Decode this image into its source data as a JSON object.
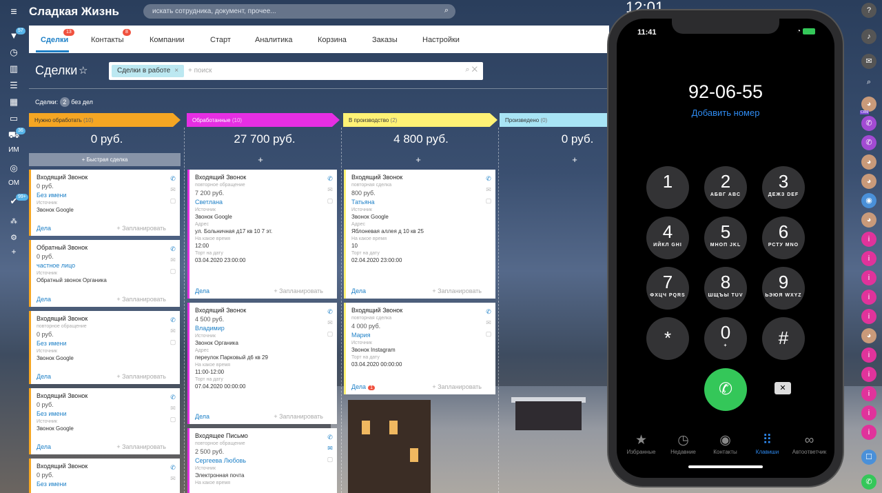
{
  "app": {
    "brand": "Сладкая Жизнь",
    "search_placeholder": "искать сотрудника, документ, прочее...",
    "clock": "12:01"
  },
  "left_sidebar": {
    "badge_top": "57",
    "badge_cart": "36",
    "badge_bottom": "99+",
    "label_im": "ИМ",
    "label_om": "ОМ"
  },
  "tabs": [
    {
      "label": "Сделки",
      "badge": "13"
    },
    {
      "label": "Контакты",
      "badge": "8"
    },
    {
      "label": "Компании"
    },
    {
      "label": "Старт"
    },
    {
      "label": "Аналитика"
    },
    {
      "label": "Корзина"
    },
    {
      "label": "Заказы"
    },
    {
      "label": "Настройки"
    }
  ],
  "page": {
    "title": "Сделки",
    "filter_chip": "Сделки в работе",
    "filter_placeholder": "+ поиск",
    "count_prefix": "Сделки:",
    "count_value": "2",
    "count_suffix": "без дел",
    "quick_deal": "Быстрая сделка"
  },
  "columns": [
    {
      "name": "Нужно обработать",
      "count": "(10)",
      "sum": "0 руб.",
      "color": "#f5a623"
    },
    {
      "name": "Обработанные",
      "count": "(10)",
      "sum": "27 700 руб.",
      "color": "#e62ee3"
    },
    {
      "name": "В производство",
      "count": "(2)",
      "sum": "4 800 руб.",
      "color": "#fff275"
    },
    {
      "name": "Произведено",
      "count": "(0)",
      "sum": "0 руб.",
      "color": "#a8e4f5"
    }
  ],
  "common": {
    "deals": "Дела",
    "plan": "+ Запланировать",
    "lbl_source": "Источник",
    "lbl_address": "Адрес",
    "lbl_time": "На какое время",
    "lbl_cake_date": "Торт на дату"
  },
  "cards": {
    "c1": {
      "title": "Входящий Звонок",
      "sum": "0 руб.",
      "client": "Без имени",
      "source": "Звонок Google"
    },
    "c2": {
      "title": "Обратный Звонок",
      "sum": "0 руб.",
      "client": "частное лицо",
      "source": "Обратный звонок Органика"
    },
    "c3": {
      "title": "Входящий Звонок",
      "sub": "повторное обращение",
      "sum": "0 руб.",
      "client": "Без имени",
      "source": "Звонок Google"
    },
    "c4": {
      "title": "Входящий Звонок",
      "sum": "0 руб.",
      "client": "Без имени",
      "source": "Звонок Google"
    },
    "c5": {
      "title": "Входящий Звонок",
      "sum": "0 руб.",
      "client": "Без имени"
    },
    "d1": {
      "title": "Входящий Звонок",
      "sub": "повторное обращение",
      "sum": "7 200 руб.",
      "client": "Светлана",
      "source": "Звонок Google",
      "address": "ул. Больничная д17 кв 10 7 эт.",
      "time": "12:00",
      "date": "03.04.2020 23:00:00"
    },
    "d2": {
      "title": "Входящий Звонок",
      "sum": "4 500 руб.",
      "client": "Владимир",
      "source": "Звонок Органика",
      "address": "переулок Парковый д6 кв 29",
      "time": "11:00-12:00",
      "date": "07.04.2020 00:00:00"
    },
    "d3": {
      "title": "Входящее Письмо",
      "sub": "повторное обращение",
      "sum": "2 500 руб.",
      "client": "Сергеева Любовь",
      "source": "Электронная почта",
      "lbl_time": "На какое время"
    },
    "p1": {
      "title": "Входящий Звонок",
      "sub": "повторная сделка",
      "sum": "800 руб.",
      "client": "Татьяна",
      "source": "Звонок Google",
      "address": "Яблоневая аллея д 10 кв 25",
      "time": "10",
      "date": "02.04.2020 23:00:00"
    },
    "p2": {
      "title": "Входящий Звонок",
      "sub": "повторная сделка",
      "sum": "4 000 руб.",
      "client": "Мария",
      "source": "Звонок Instagram",
      "date": "03.04.2020 00:00:00",
      "deals_badge": "1"
    }
  },
  "phone": {
    "time": "11:41",
    "number": "92-06-55",
    "add_number": "Добавить номер",
    "keys": [
      {
        "d": "1",
        "l": ""
      },
      {
        "d": "2",
        "l": "АБВГ ABC"
      },
      {
        "d": "3",
        "l": "ДЕЖЗ DEF"
      },
      {
        "d": "4",
        "l": "ИЙКЛ GHI"
      },
      {
        "d": "5",
        "l": "МНОП JKL"
      },
      {
        "d": "6",
        "l": "РСТУ MNO"
      },
      {
        "d": "7",
        "l": "ФХЦЧ PQRS"
      },
      {
        "d": "8",
        "l": "ШЩЪЫ TUV"
      },
      {
        "d": "9",
        "l": "ЬЭЮЯ WXYZ"
      },
      {
        "d": "*",
        "l": ""
      },
      {
        "d": "0",
        "l": "+"
      },
      {
        "d": "#",
        "l": ""
      }
    ],
    "tabbar": [
      "Избранные",
      "Недавние",
      "Контакты",
      "Клавиши",
      "Автоответчик"
    ]
  },
  "right_sidebar": {
    "crm": "CRM"
  }
}
